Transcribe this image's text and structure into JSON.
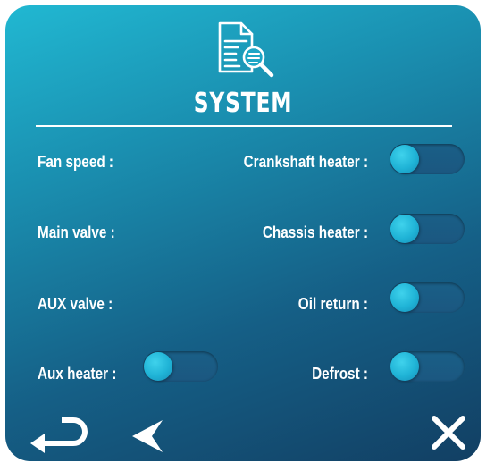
{
  "header": {
    "title": "SYSTEM",
    "icon": "document-search-icon"
  },
  "left_items": [
    {
      "label": "Fan speed :"
    },
    {
      "label": "Main valve :"
    },
    {
      "label": "AUX valve :"
    },
    {
      "label": "Aux heater :",
      "toggle_on": false
    }
  ],
  "right_items": [
    {
      "label": "Crankshaft heater :",
      "toggle_on": false
    },
    {
      "label": "Chassis heater :",
      "toggle_on": false
    },
    {
      "label": "Oil return :",
      "toggle_on": false
    },
    {
      "label": "Defrost :",
      "toggle_on": false
    }
  ],
  "footer": {
    "return_icon": "return-arrow-icon",
    "back_icon": "back-arrow-icon",
    "close_icon": "close-icon"
  },
  "colors": {
    "panel_top": "#21b8d2",
    "panel_bottom": "#123f63",
    "toggle_track": "#1a5f87",
    "toggle_knob": "#1fb3d6",
    "text": "#ffffff"
  }
}
